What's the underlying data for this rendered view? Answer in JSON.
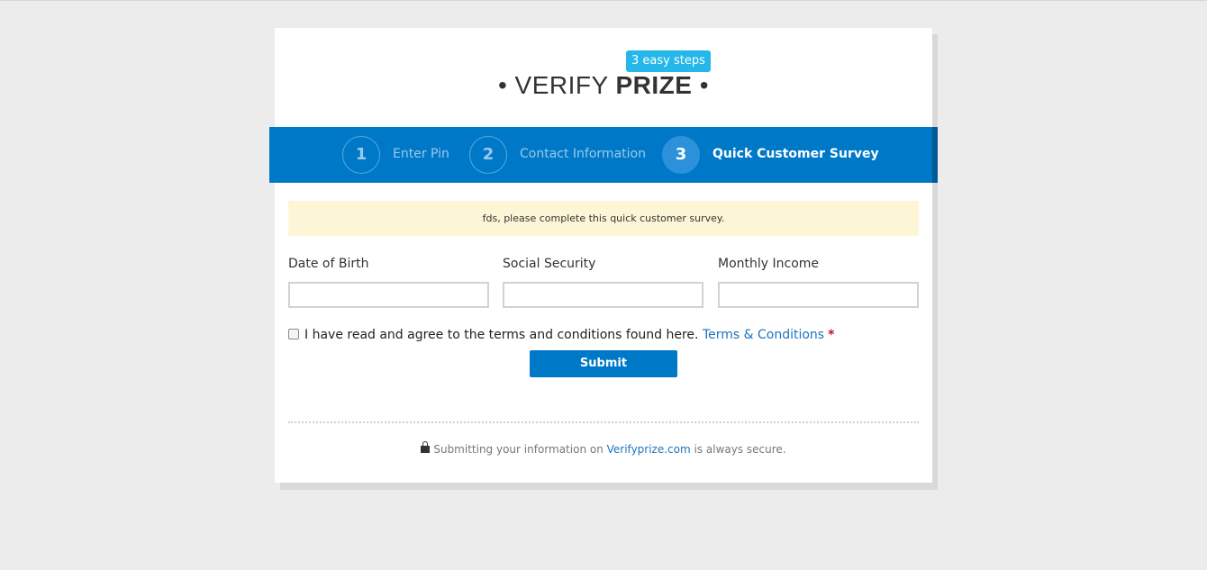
{
  "header": {
    "badge": "3 easy steps",
    "title_prefix": "• VERIFY ",
    "title_bold": "PRIZE",
    "title_suffix": " •"
  },
  "steps": [
    {
      "number": "1",
      "label": "Enter Pin",
      "active": false
    },
    {
      "number": "2",
      "label": "Contact Information",
      "active": false
    },
    {
      "number": "3",
      "label": "Quick Customer Survey",
      "active": true
    }
  ],
  "notice": "fds, please complete this quick customer survey.",
  "form": {
    "fields": [
      {
        "label": "Date of Birth",
        "value": ""
      },
      {
        "label": "Social Security",
        "value": ""
      },
      {
        "label": "Monthly Income",
        "value": ""
      }
    ],
    "terms_text": "I have read and agree to the terms and conditions found here.",
    "terms_link": "Terms & Conditions",
    "required_mark": "*",
    "submit_label": "Submit"
  },
  "footer": {
    "text_before": "Submitting your information on ",
    "link": "Verifyprize.com",
    "text_after": " is always secure."
  },
  "colors": {
    "accent": "#0078c8",
    "badge": "#25b7ea",
    "notice_bg": "#fdf6d6",
    "link": "#1e73be",
    "required": "#c8102e"
  }
}
